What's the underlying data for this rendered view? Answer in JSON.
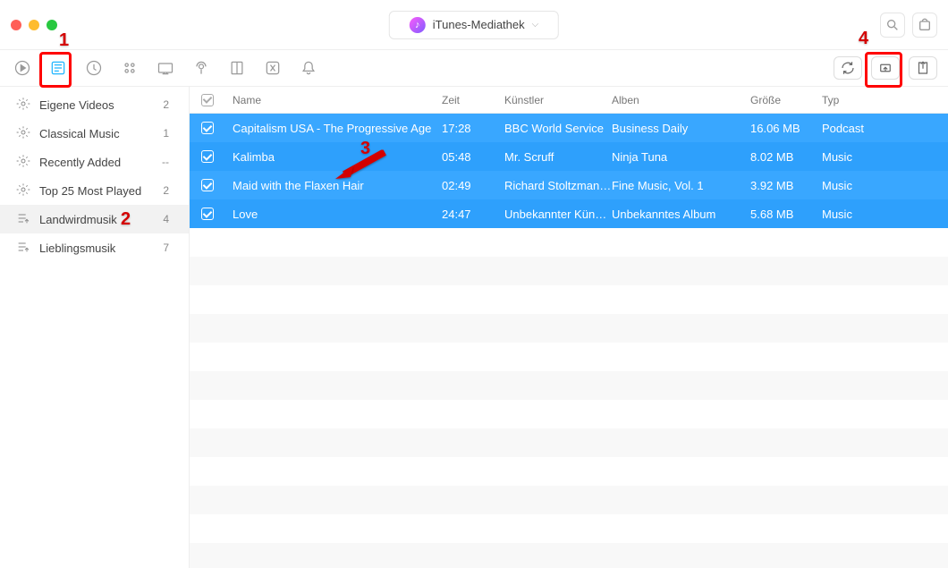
{
  "window": {
    "title": "iTunes-Mediathek"
  },
  "toolbar_icons": [
    "play",
    "playlist",
    "disc",
    "games",
    "tv",
    "podcast",
    "audiobook",
    "apps",
    "bell"
  ],
  "toolbar_right": [
    "refresh",
    "send-to-device",
    "export"
  ],
  "sidebar": {
    "items": [
      {
        "icon": "gear",
        "label": "Eigene Videos",
        "count": "2"
      },
      {
        "icon": "gear",
        "label": "Classical Music",
        "count": "1"
      },
      {
        "icon": "gear",
        "label": "Recently Added",
        "count": "--"
      },
      {
        "icon": "gear",
        "label": "Top 25 Most Played",
        "count": "2"
      },
      {
        "icon": "list",
        "label": "Landwirdmusik",
        "count": "4",
        "selected": true
      },
      {
        "icon": "list",
        "label": "Lieblingsmusik",
        "count": "7"
      }
    ]
  },
  "table": {
    "headers": {
      "name": "Name",
      "time": "Zeit",
      "artist": "Künstler",
      "album": "Alben",
      "size": "Größe",
      "type": "Typ"
    },
    "rows": [
      {
        "name": "Capitalism USA - The Progressive Age",
        "time": "17:28",
        "artist": "BBC World Service",
        "album": "Business Daily",
        "size": "16.06 MB",
        "type": "Podcast"
      },
      {
        "name": "Kalimba",
        "time": "05:48",
        "artist": "Mr. Scruff",
        "album": "Ninja Tuna",
        "size": "8.02 MB",
        "type": "Music"
      },
      {
        "name": "Maid with the Flaxen Hair",
        "time": "02:49",
        "artist": "Richard Stoltzman/Slo...",
        "album": "Fine Music, Vol. 1",
        "size": "3.92 MB",
        "type": "Music"
      },
      {
        "name": "Love",
        "time": "24:47",
        "artist": "Unbekannter Künstler",
        "album": "Unbekanntes Album",
        "size": "5.68 MB",
        "type": "Music"
      }
    ]
  },
  "annotations": {
    "1": "1",
    "2": "2",
    "3": "3",
    "4": "4"
  }
}
